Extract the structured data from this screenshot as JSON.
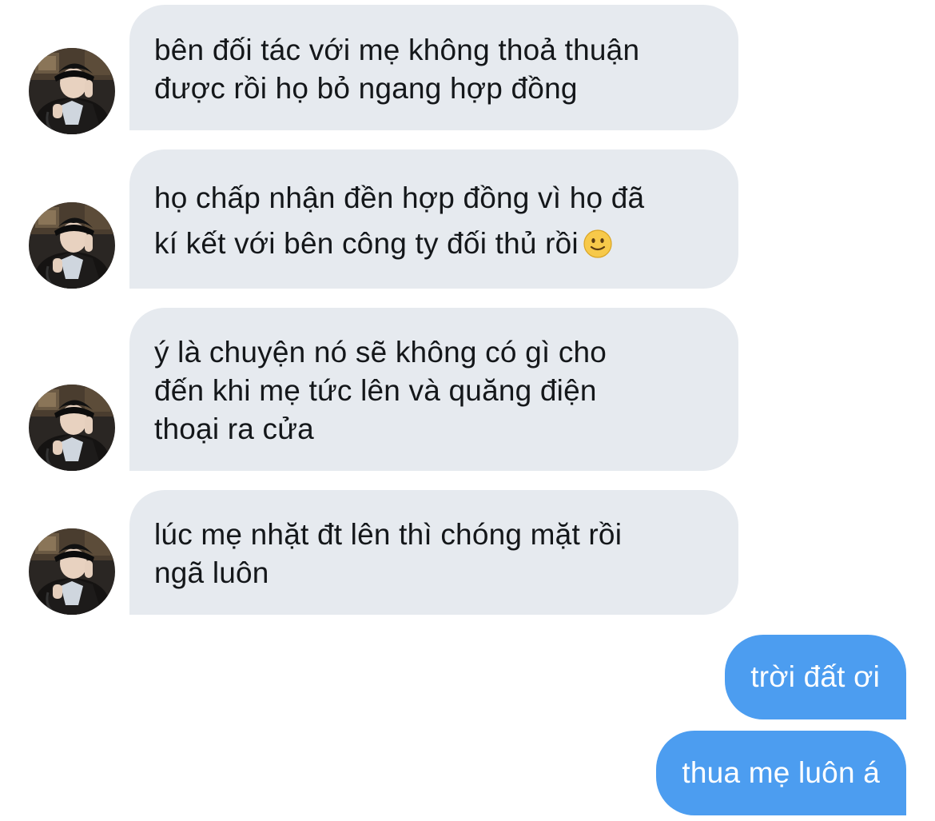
{
  "conversation": {
    "received": [
      {
        "lines": [
          "bên đối tác với mẹ không thoả thuận",
          "được rồi họ bỏ ngang hợp đồng"
        ]
      },
      {
        "lines": [
          "họ chấp nhận đền hợp đồng vì họ đã",
          "kí kết với bên công ty đối thủ rồi"
        ],
        "emoji": "slightly-smiling-face"
      },
      {
        "lines": [
          "ý là chuyện nó sẽ không có gì cho",
          "đến khi mẹ tức lên và quăng điện",
          "thoại ra cửa"
        ]
      },
      {
        "lines": [
          "lúc mẹ nhặt đt lên thì chóng mặt rồi",
          "ngã luôn"
        ]
      }
    ],
    "sent": [
      {
        "text": "trời đất ơi"
      },
      {
        "text": "thua mẹ luôn á"
      }
    ]
  },
  "colors": {
    "received_bubble": "#e6eaef",
    "received_text": "#14171a",
    "sent_bubble": "#4c9df0",
    "sent_text": "#ffffff",
    "background": "#ffffff"
  },
  "icons": {
    "avatar": "user-avatar-photo",
    "emoji": "slightly-smiling-face"
  }
}
